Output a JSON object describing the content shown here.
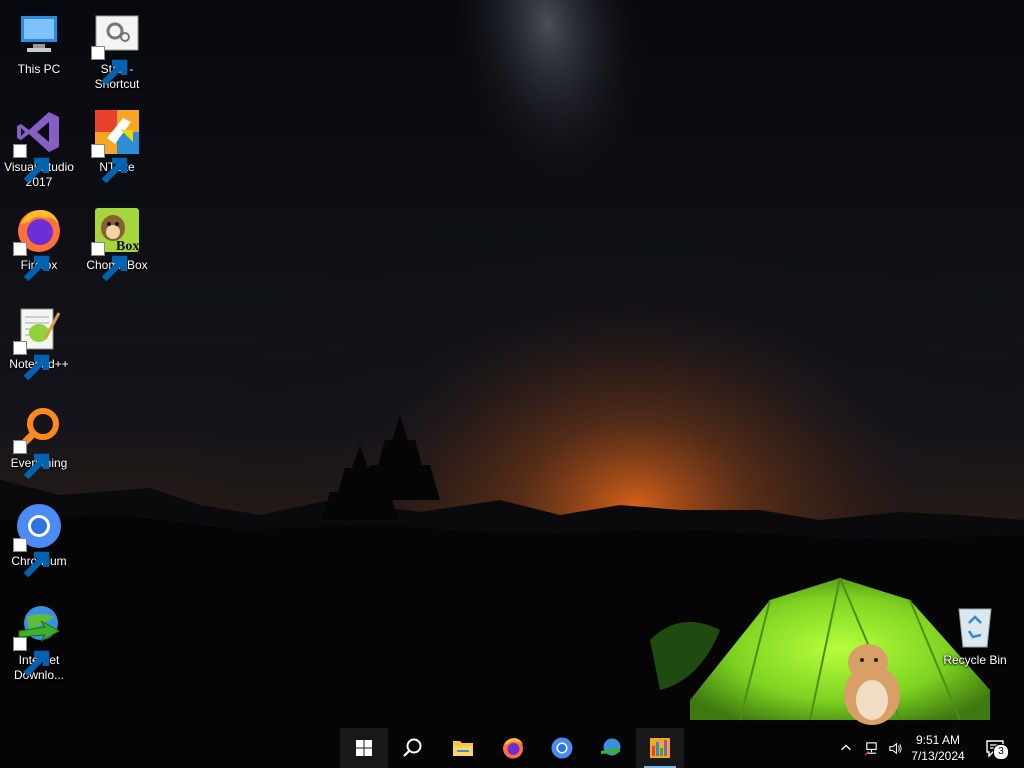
{
  "desktop": {
    "icons": [
      {
        "label": "This PC",
        "icon": "this-pc-icon",
        "shortcut": false
      },
      {
        "label": "Start - Shortcut",
        "icon": "start-shortcut-icon",
        "shortcut": true
      },
      {
        "label": "Visual Studio 2017",
        "icon": "visual-studio-icon",
        "shortcut": true
      },
      {
        "label": "NTLite",
        "icon": "ntlite-icon",
        "shortcut": true
      },
      {
        "label": "Firefox",
        "icon": "firefox-icon",
        "shortcut": true
      },
      {
        "label": "ChomikBox",
        "icon": "chomikbox-icon",
        "shortcut": true,
        "badge_text": "Box"
      },
      {
        "label": "Notepad++",
        "icon": "notepad-plus-plus-icon",
        "shortcut": true
      },
      {
        "label": "Everything",
        "icon": "everything-search-icon",
        "shortcut": true
      },
      {
        "label": "Chromium",
        "icon": "chromium-icon",
        "shortcut": true
      },
      {
        "label": "Internet Downlo...",
        "icon": "internet-download-manager-icon",
        "shortcut": true
      },
      {
        "label": "Recycle Bin",
        "icon": "recycle-bin-icon",
        "shortcut": false
      }
    ]
  },
  "taskbar": {
    "buttons": [
      {
        "name": "start",
        "icon": "windows-logo-icon"
      },
      {
        "name": "search",
        "icon": "search-icon"
      },
      {
        "name": "file-explorer",
        "icon": "folder-icon"
      },
      {
        "name": "firefox",
        "icon": "firefox-icon"
      },
      {
        "name": "chromium",
        "icon": "chromium-icon"
      },
      {
        "name": "internet-download-manager",
        "icon": "internet-download-manager-icon"
      },
      {
        "name": "app-chart",
        "icon": "bar-chart-app-icon",
        "running": true
      }
    ],
    "tray": {
      "icons": [
        "chevron-up-icon",
        "network-icon",
        "volume-icon"
      ],
      "time": "9:51 AM",
      "date": "7/13/2024",
      "notification_count": "3"
    }
  },
  "colors": {
    "sky_top": "#05070c",
    "horizon_glow": "#e0651a",
    "tent_green": "#7ed321",
    "taskbar_accent": "#76b9ed"
  }
}
